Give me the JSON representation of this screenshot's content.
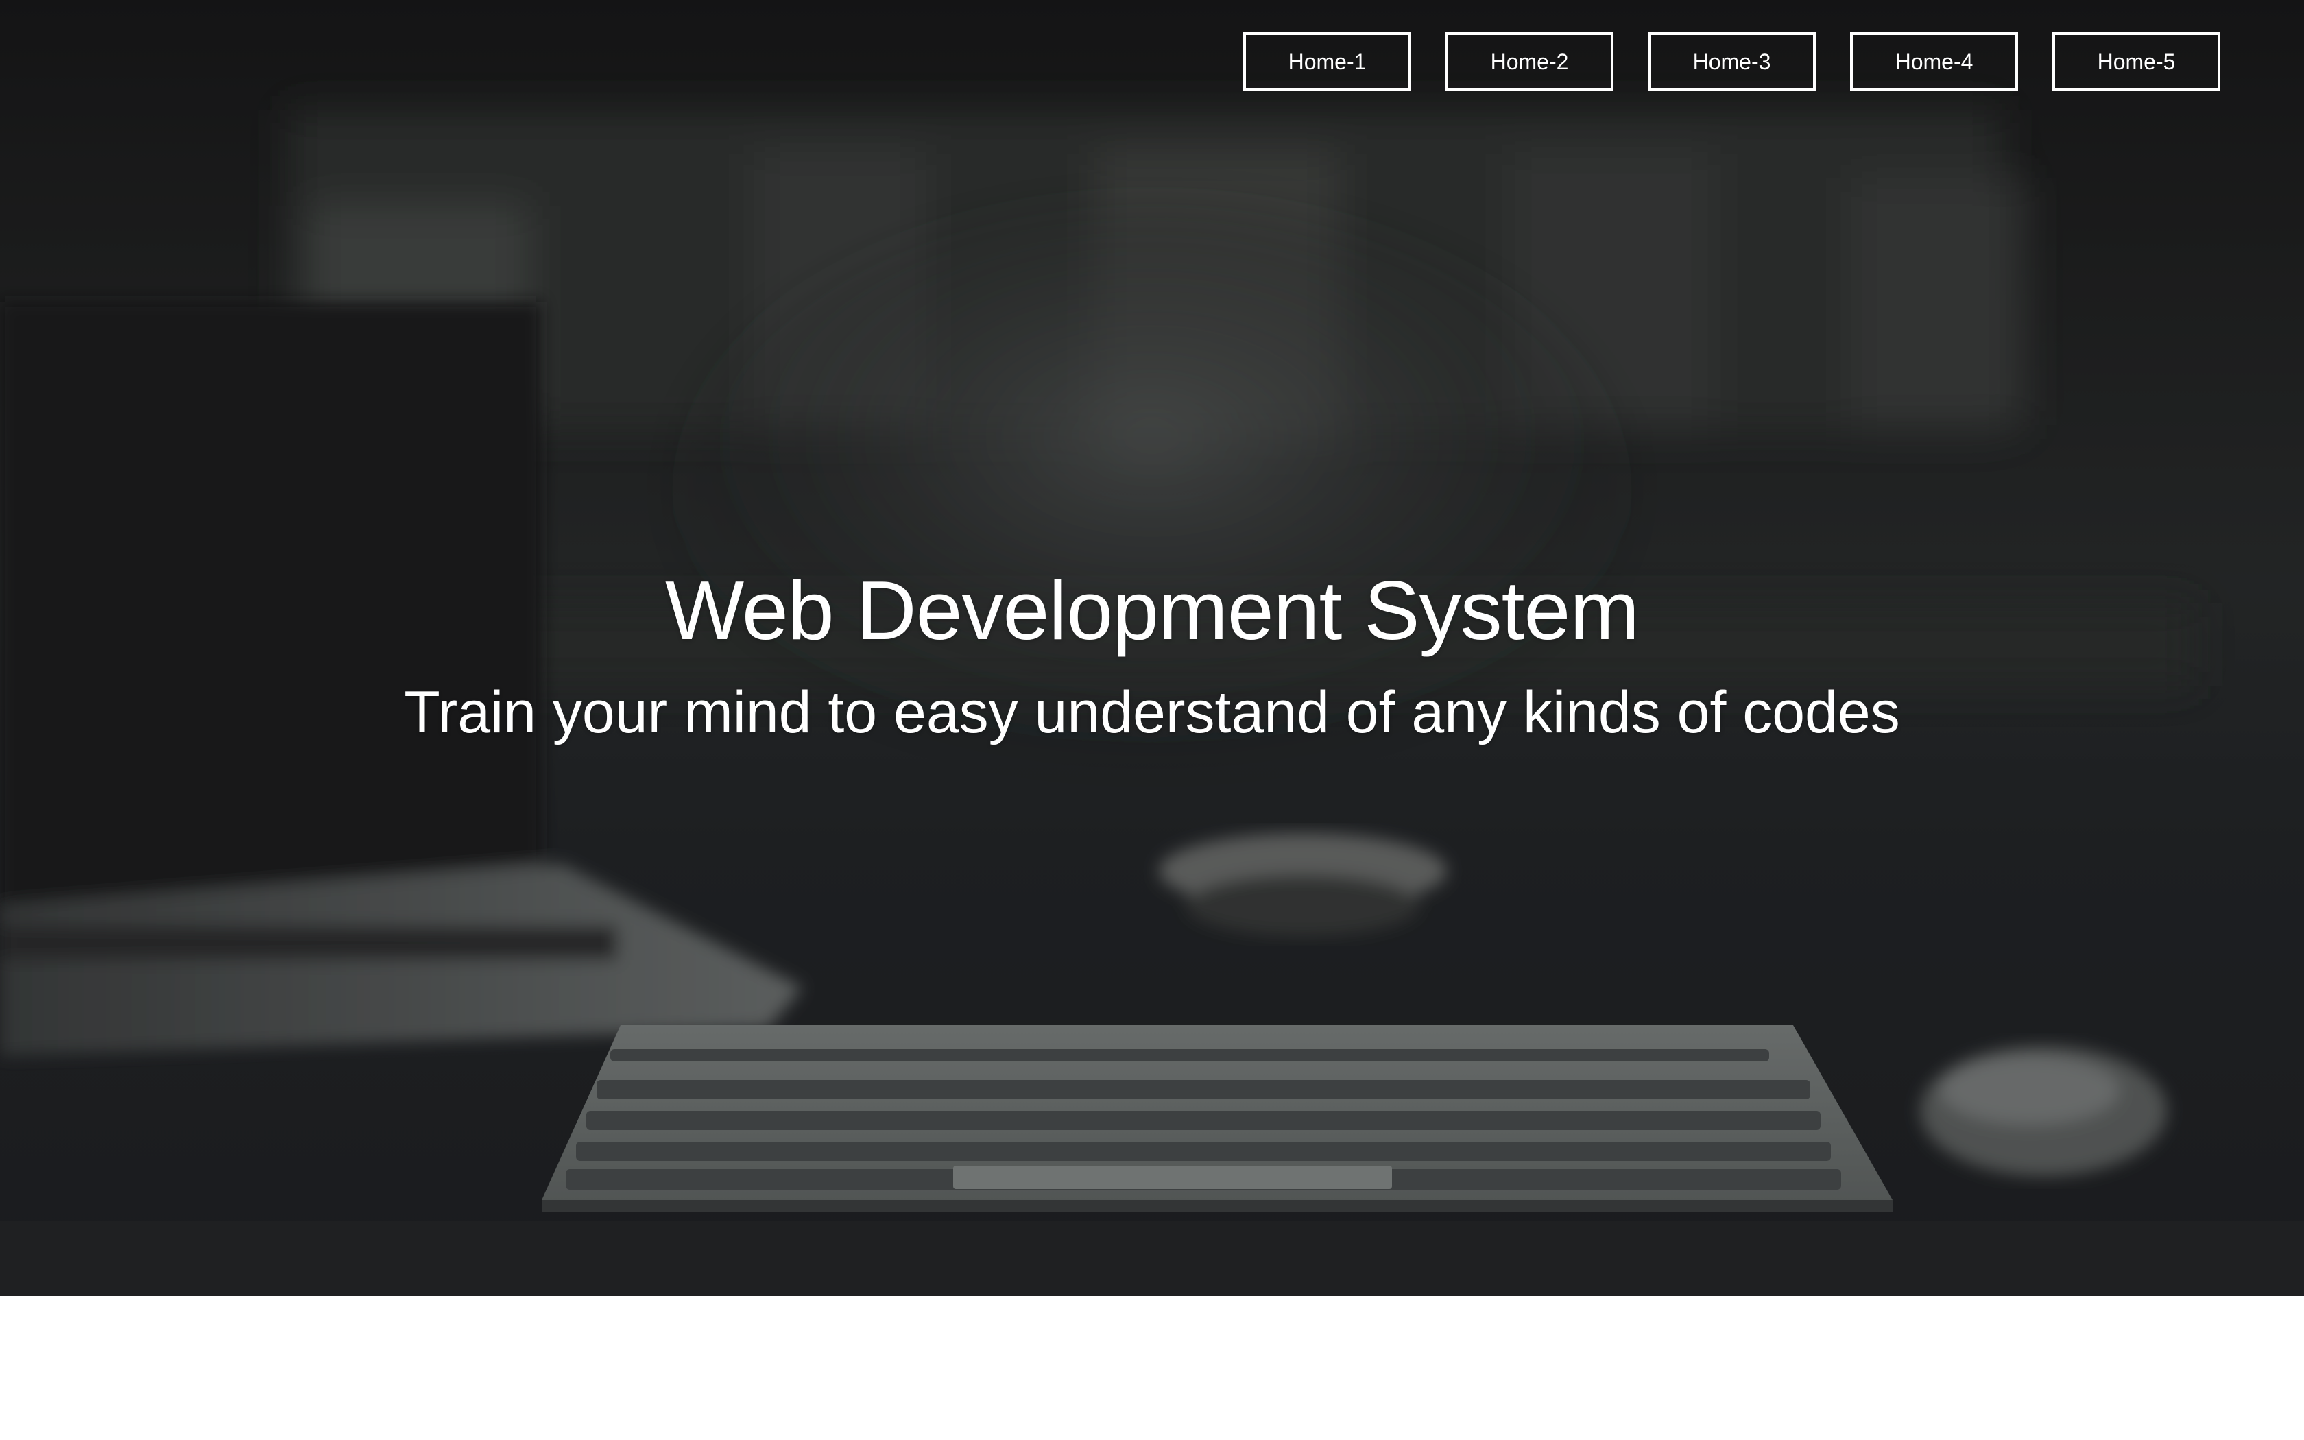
{
  "nav": {
    "items": [
      {
        "label": "Home-1"
      },
      {
        "label": "Home-2"
      },
      {
        "label": "Home-3"
      },
      {
        "label": "Home-4"
      },
      {
        "label": "Home-5"
      }
    ]
  },
  "hero": {
    "title": "Web Development System",
    "subtitle": "Train your mind to easy understand of any kinds of codes"
  },
  "colors": {
    "text": "#ffffff",
    "overlay": "#1c1e1f",
    "page_background": "#ffffff"
  }
}
